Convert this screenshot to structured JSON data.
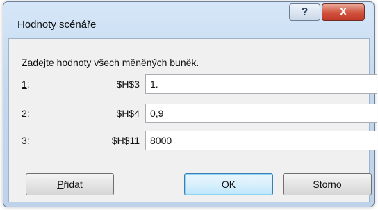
{
  "window": {
    "title": "Hodnoty scénáře",
    "help_label": "?",
    "close_label": "X"
  },
  "instruction": "Zadejte hodnoty všech měněných buněk.",
  "rows": [
    {
      "num": "1",
      "suffix": ":",
      "address": "$H$3",
      "value": "1."
    },
    {
      "num": "2",
      "suffix": ":",
      "address": "$H$4",
      "value": "0,9"
    },
    {
      "num": "3",
      "suffix": ":",
      "address": "$H$11",
      "value": "8000"
    }
  ],
  "buttons": {
    "add_mnemonic": "P",
    "add_rest": "řidat",
    "ok": "OK",
    "cancel": "Storno"
  }
}
